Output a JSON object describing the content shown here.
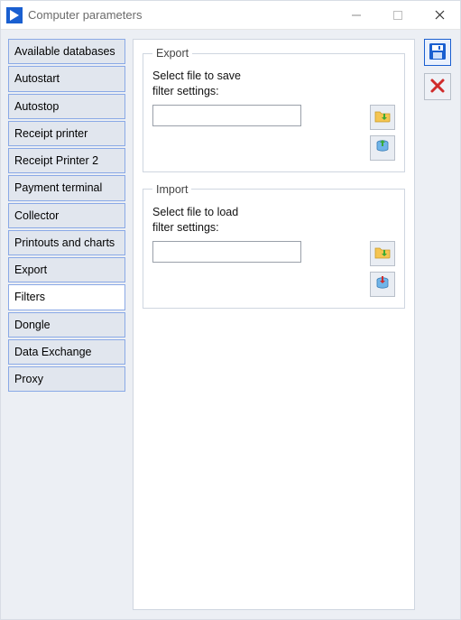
{
  "window": {
    "title": "Computer parameters"
  },
  "sidebar": {
    "items": [
      {
        "label": "Available databases",
        "selected": false
      },
      {
        "label": "Autostart",
        "selected": false
      },
      {
        "label": "Autostop",
        "selected": false
      },
      {
        "label": "Receipt printer",
        "selected": false
      },
      {
        "label": "Receipt Printer 2",
        "selected": false
      },
      {
        "label": "Payment terminal",
        "selected": false
      },
      {
        "label": "Collector",
        "selected": false
      },
      {
        "label": "Printouts and charts",
        "selected": false
      },
      {
        "label": "Export",
        "selected": false
      },
      {
        "label": "Filters",
        "selected": true
      },
      {
        "label": "Dongle",
        "selected": false
      },
      {
        "label": "Data Exchange",
        "selected": false
      },
      {
        "label": "Proxy",
        "selected": false
      }
    ]
  },
  "panel": {
    "export": {
      "legend": "Export",
      "help": "Select file to save\nfilter settings:",
      "path": ""
    },
    "import": {
      "legend": "Import",
      "help": "Select file to load\nfilter settings:",
      "path": ""
    }
  },
  "icons": {
    "save": "floppy-icon",
    "cancel": "cancel-x-icon",
    "browse": "folder-arrow-icon",
    "applyExport": "db-export-icon",
    "applyImport": "db-import-icon"
  },
  "colors": {
    "accent": "#1a5fd0",
    "tabBorder": "#8aa9e6",
    "red": "#d02b2b",
    "green": "#3aaa35",
    "orange": "#f5a623"
  }
}
